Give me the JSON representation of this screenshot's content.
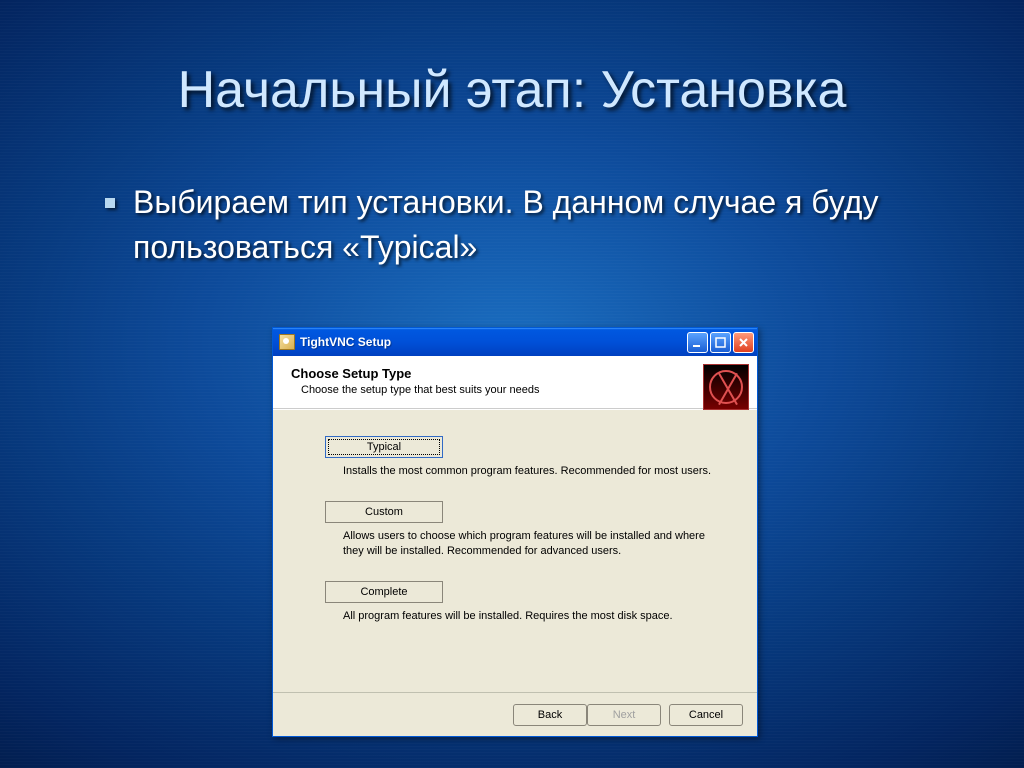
{
  "slide": {
    "title": "Начальный этап: Установка",
    "bullet": "Выбираем тип установки. В данном случае я буду пользоваться «Typical»"
  },
  "window": {
    "title": "TightVNC Setup",
    "header_title": "Choose Setup Type",
    "header_subtitle": "Choose the setup type that best suits your needs",
    "options": {
      "typical": {
        "label": "Typical",
        "desc": "Installs the most common program features. Recommended for most users."
      },
      "custom": {
        "label": "Custom",
        "desc": "Allows users to choose which program features will be installed and where they will be installed. Recommended for advanced users."
      },
      "complete": {
        "label": "Complete",
        "desc": "All program features will be installed. Requires the most disk space."
      }
    },
    "buttons": {
      "back": "Back",
      "next": "Next",
      "cancel": "Cancel"
    }
  }
}
